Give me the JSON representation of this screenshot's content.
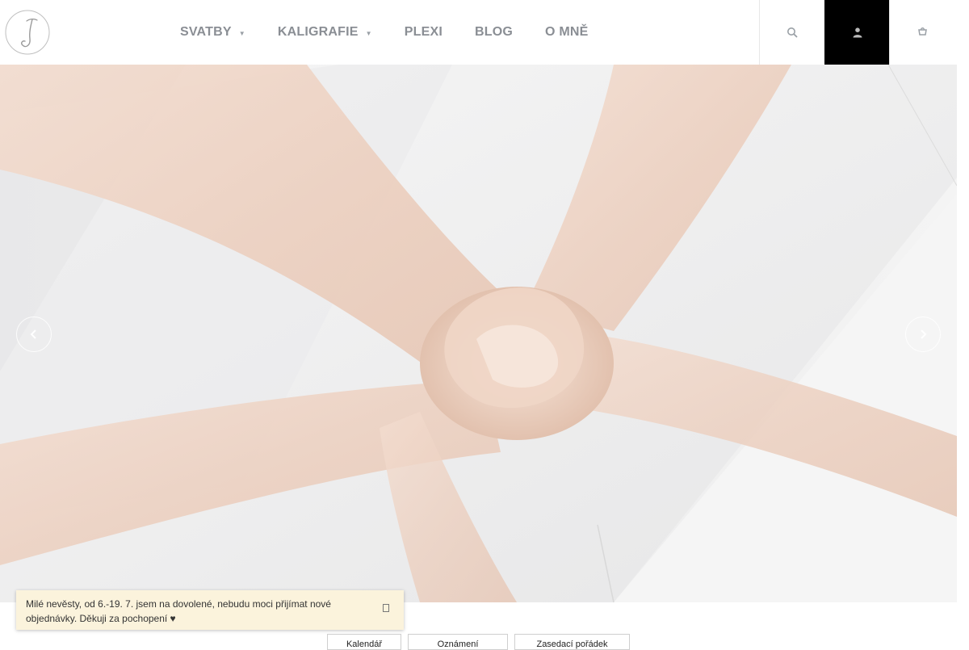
{
  "header": {
    "logo_alt": "J",
    "nav": [
      {
        "label": "SVATBY",
        "has_dropdown": true
      },
      {
        "label": "KALIGRAFIE",
        "has_dropdown": true
      },
      {
        "label": "PLEXI",
        "has_dropdown": false
      },
      {
        "label": "BLOG",
        "has_dropdown": false
      },
      {
        "label": "O MNĚ",
        "has_dropdown": false
      }
    ],
    "tools": [
      {
        "icon": "search-icon"
      },
      {
        "icon": "user-icon"
      },
      {
        "icon": "cart-icon"
      }
    ]
  },
  "hero": {
    "image": "white envelopes tied with blush chiffon silk ribbon",
    "prev_icon": "chevron-left-icon",
    "next_icon": "chevron-right-icon"
  },
  "notice": {
    "text": "Milé nevěsty, od 6.-19. 7. jsem na dovolené, nebudu moci přijímat nové objednávky. Děkuji za pochopení ♥",
    "close_icon": "close-icon"
  },
  "bottom_buttons": [
    {
      "label": "Kalendář"
    },
    {
      "label": "Oznámení"
    },
    {
      "label": "Zasedací pořádek"
    }
  ],
  "colors": {
    "nav_text": "#8a8e94",
    "notice_bg": "#fbf3dc",
    "ribbon": "#f0d6c8",
    "active_tool_bg": "#000000"
  }
}
